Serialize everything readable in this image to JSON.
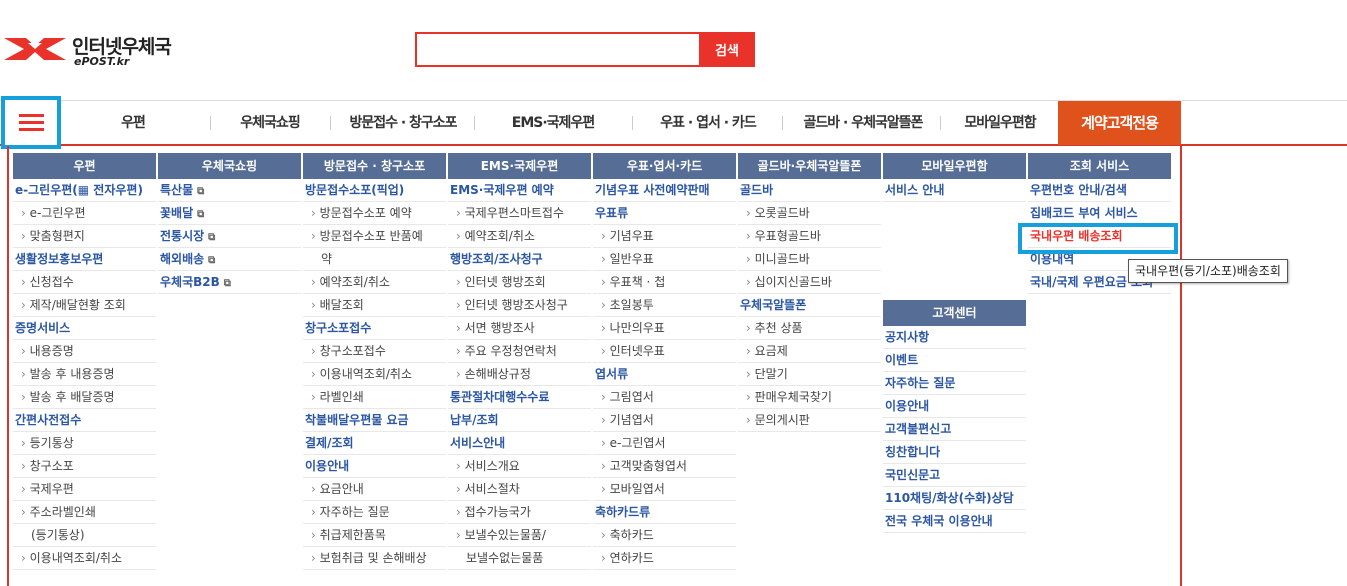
{
  "header": {
    "logo_text": "인터넷우체국",
    "logo_sub": "ePOST.kr",
    "search_placeholder": "",
    "search_button": "검색"
  },
  "gnb": {
    "items": [
      "우편",
      "우체국쇼핑",
      "방문접수 · 창구소포",
      "EMS·국제우편",
      "우표 · 엽서 · 카드",
      "골드바 · 우체국알뜰폰",
      "모바일우편함"
    ],
    "contract": "계약고객전용"
  },
  "menu": {
    "col1": {
      "head": "우편",
      "items": [
        {
          "t": "e-그린우편(▦ 전자우편)",
          "k": "sec"
        },
        {
          "t": "e-그린우편",
          "k": "sub"
        },
        {
          "t": "맞춤형편지",
          "k": "sub"
        },
        {
          "t": "생활정보홍보우편",
          "k": "sec"
        },
        {
          "t": "신청접수",
          "k": "sub"
        },
        {
          "t": "제작/배달현황 조회",
          "k": "sub"
        },
        {
          "t": "증명서비스",
          "k": "sec"
        },
        {
          "t": "내용증명",
          "k": "sub"
        },
        {
          "t": "발송 후 내용증명",
          "k": "sub"
        },
        {
          "t": "발송 후 배달증명",
          "k": "sub"
        },
        {
          "t": "간편사전접수",
          "k": "sec"
        },
        {
          "t": "등기통상",
          "k": "sub"
        },
        {
          "t": "창구소포",
          "k": "sub"
        },
        {
          "t": "국제우편",
          "k": "sub"
        },
        {
          "t": "주소라벨인쇄",
          "k": "sub"
        },
        {
          "t": "(등기통상)",
          "k": "wrap"
        },
        {
          "t": "이용내역조회/취소",
          "k": "sub"
        }
      ]
    },
    "col2": {
      "head": "우체국쇼핑",
      "items": [
        {
          "t": "특산물",
          "k": "sec",
          "ext": true
        },
        {
          "t": "꽃배달",
          "k": "sec",
          "ext": true
        },
        {
          "t": "전통시장",
          "k": "sec",
          "ext": true
        },
        {
          "t": "해외배송",
          "k": "sec",
          "ext": true
        },
        {
          "t": "우체국B2B",
          "k": "sec",
          "ext": true
        }
      ]
    },
    "col3": {
      "head": "방문접수 · 창구소포",
      "items": [
        {
          "t": "방문접수소포(픽업)",
          "k": "sec"
        },
        {
          "t": "방문접수소포 예약",
          "k": "sub"
        },
        {
          "t": "방문접수소포 반품예",
          "k": "sub"
        },
        {
          "t": "약",
          "k": "wrap"
        },
        {
          "t": "예약조회/취소",
          "k": "sub"
        },
        {
          "t": "배달조회",
          "k": "sub"
        },
        {
          "t": "창구소포접수",
          "k": "sec"
        },
        {
          "t": "창구소포접수",
          "k": "sub"
        },
        {
          "t": "이용내역조회/취소",
          "k": "sub"
        },
        {
          "t": "라벨인쇄",
          "k": "sub"
        },
        {
          "t": "착불배달우편물 요금",
          "k": "sec"
        },
        {
          "t": "결제/조회",
          "k": "sec"
        },
        {
          "t": "이용안내",
          "k": "sec"
        },
        {
          "t": "요금안내",
          "k": "sub"
        },
        {
          "t": "자주하는 질문",
          "k": "sub"
        },
        {
          "t": "취급제한품목",
          "k": "sub"
        },
        {
          "t": "보험취급 및 손해배상",
          "k": "sub"
        }
      ]
    },
    "col4": {
      "head": "EMS·국제우편",
      "items": [
        {
          "t": "EMS·국제우편 예약",
          "k": "sec"
        },
        {
          "t": "국제우편스마트접수",
          "k": "sub"
        },
        {
          "t": "예약조회/취소",
          "k": "sub"
        },
        {
          "t": "행방조회/조사청구",
          "k": "sec"
        },
        {
          "t": "인터넷 행방조회",
          "k": "sub"
        },
        {
          "t": "인터넷 행방조사청구",
          "k": "sub"
        },
        {
          "t": "서면 행방조사",
          "k": "sub"
        },
        {
          "t": "주요 우정청연락처",
          "k": "sub"
        },
        {
          "t": "손해배상규정",
          "k": "sub"
        },
        {
          "t": "통관절차대행수수료",
          "k": "sec"
        },
        {
          "t": "납부/조회",
          "k": "sec"
        },
        {
          "t": "서비스안내",
          "k": "sec"
        },
        {
          "t": "서비스개요",
          "k": "sub"
        },
        {
          "t": "서비스절차",
          "k": "sub"
        },
        {
          "t": "접수가능국가",
          "k": "sub"
        },
        {
          "t": "보낼수있는물품/",
          "k": "sub"
        },
        {
          "t": "보낼수없는물품",
          "k": "wrap"
        }
      ]
    },
    "col5": {
      "head": "우표·엽서·카드",
      "items": [
        {
          "t": "기념우표 사전예약판매",
          "k": "sec"
        },
        {
          "t": "우표류",
          "k": "sec"
        },
        {
          "t": "기념우표",
          "k": "sub"
        },
        {
          "t": "일반우표",
          "k": "sub"
        },
        {
          "t": "우표책 · 첩",
          "k": "sub"
        },
        {
          "t": "초일봉투",
          "k": "sub"
        },
        {
          "t": "나만의우표",
          "k": "sub"
        },
        {
          "t": "인터넷우표",
          "k": "sub"
        },
        {
          "t": "엽서류",
          "k": "sec"
        },
        {
          "t": "그림엽서",
          "k": "sub"
        },
        {
          "t": "기념엽서",
          "k": "sub"
        },
        {
          "t": "e-그린엽서",
          "k": "sub"
        },
        {
          "t": "고객맞춤형엽서",
          "k": "sub"
        },
        {
          "t": "모바일엽서",
          "k": "sub"
        },
        {
          "t": "축하카드류",
          "k": "sec"
        },
        {
          "t": "축하카드",
          "k": "sub"
        },
        {
          "t": "연하카드",
          "k": "sub"
        }
      ]
    },
    "col6": {
      "head": "골드바·우체국알뜰폰",
      "items": [
        {
          "t": "골드바",
          "k": "sec"
        },
        {
          "t": "오롯골드바",
          "k": "sub"
        },
        {
          "t": "우표형골드바",
          "k": "sub"
        },
        {
          "t": "미니골드바",
          "k": "sub"
        },
        {
          "t": "십이지신골드바",
          "k": "sub"
        },
        {
          "t": "우체국알뜰폰",
          "k": "sec"
        },
        {
          "t": "추천 상품",
          "k": "sub"
        },
        {
          "t": "요금제",
          "k": "sub"
        },
        {
          "t": "단말기",
          "k": "sub"
        },
        {
          "t": "판매우체국찾기",
          "k": "sub"
        },
        {
          "t": "문의게시판",
          "k": "sub"
        }
      ]
    },
    "col7": {
      "head": "모바일우편함",
      "items": [
        {
          "t": "서비스 안내",
          "k": "sec"
        }
      ]
    },
    "col7b": {
      "head": "고객센터",
      "items": [
        {
          "t": "공지사항",
          "k": "sec"
        },
        {
          "t": "이벤트",
          "k": "sec"
        },
        {
          "t": "자주하는 질문",
          "k": "sec"
        },
        {
          "t": "이용안내",
          "k": "sec"
        },
        {
          "t": "고객불편신고",
          "k": "sec"
        },
        {
          "t": "칭찬합니다",
          "k": "sec"
        },
        {
          "t": "국민신문고",
          "k": "sec"
        },
        {
          "t": "110채팅/화상(수화)상담",
          "k": "sec"
        },
        {
          "t": "전국 우체국 이용안내",
          "k": "sec"
        }
      ]
    },
    "col8": {
      "head": "조회 서비스",
      "items": [
        {
          "t": "우편번호 안내/검색",
          "k": "sec"
        },
        {
          "t": "집배코드 부여 서비스",
          "k": "sec"
        },
        {
          "t": "국내우편 배송조회",
          "k": "sec",
          "red": true
        },
        {
          "t": "이용내역",
          "k": "sec"
        },
        {
          "t": "국내/국제 우편요금 조회",
          "k": "sec"
        }
      ]
    }
  },
  "tooltip": "국내우편(등기/소포)배송조회",
  "colors": {
    "accent": "#e8322a",
    "nav_head": "#566e95",
    "link": "#2a56a3",
    "highlight": "#16a0db",
    "contract": "#e0521c"
  }
}
